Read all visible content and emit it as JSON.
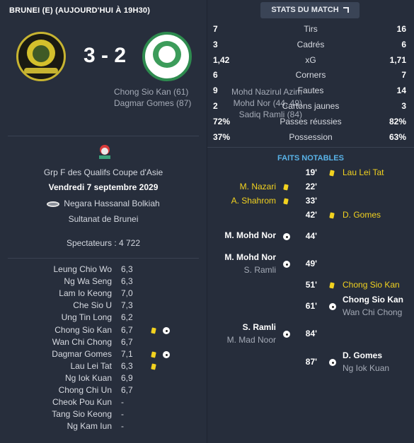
{
  "match": {
    "title": "BRUNEI (E) (AUJOURD'HUI À 19H30)",
    "score": "3 - 2",
    "home_crest": "brunei-crest",
    "away_crest": "macau-crest",
    "home_scorers": [
      "Mohd Nazirul Azim",
      "Mohd Nor (44, 49)",
      "Sadiq Ramli (84)"
    ],
    "away_scorers": [
      "Chong Sio Kan (61)",
      "Dagmar Gomes (87)"
    ],
    "competition": "Grp F des Qualifs Coupe d'Asie",
    "date": "Vendredi 7 septembre 2029",
    "stadium": "Negara Hassanal Bolkiah",
    "city": "Sultanat de Brunei",
    "attendance": "Spectateurs : 4 722"
  },
  "ratings": [
    {
      "name": "Leung Chio Wo",
      "rating": "6,3",
      "card": false,
      "goal": false
    },
    {
      "name": "Ng Wa Seng",
      "rating": "6,3",
      "card": false,
      "goal": false
    },
    {
      "name": "Lam Io Keong",
      "rating": "7,0",
      "card": false,
      "goal": false
    },
    {
      "name": "Che Sio U",
      "rating": "7,3",
      "card": false,
      "goal": false
    },
    {
      "name": "Ung Tin Long",
      "rating": "6,2",
      "card": false,
      "goal": false
    },
    {
      "name": "Chong Sio Kan",
      "rating": "6,7",
      "card": true,
      "goal": true
    },
    {
      "name": "Wan Chi Chong",
      "rating": "6,7",
      "card": false,
      "goal": false
    },
    {
      "name": "Dagmar Gomes",
      "rating": "7,1",
      "card": true,
      "goal": true
    },
    {
      "name": "Lau Lei Tat",
      "rating": "6,3",
      "card": true,
      "goal": false
    },
    {
      "name": "Ng Iok Kuan",
      "rating": "6,9",
      "card": false,
      "goal": false
    },
    {
      "name": "Chong Chi Un",
      "rating": "6,7",
      "card": false,
      "goal": false
    },
    {
      "name": "Cheok Pou Kun",
      "rating": "-",
      "card": false,
      "goal": false
    },
    {
      "name": "Tang Sio Keong",
      "rating": "-",
      "card": false,
      "goal": false
    },
    {
      "name": "Ng Kam Iun",
      "rating": "-",
      "card": false,
      "goal": false
    }
  ],
  "stats_button": "STATS DU MATCH",
  "stats": [
    {
      "home": "7",
      "label": "Tirs",
      "away": "16",
      "bold": false
    },
    {
      "home": "3",
      "label": "Cadrés",
      "away": "6",
      "bold": false
    },
    {
      "home": "1,42",
      "label": "xG",
      "away": "1,71",
      "bold": false
    },
    {
      "home": "6",
      "label": "Corners",
      "away": "7",
      "bold": false
    },
    {
      "home": "9",
      "label": "Fautes",
      "away": "14",
      "bold": false
    },
    {
      "home": "2",
      "label": "Cartons jaunes",
      "away": "3",
      "bold": false
    },
    {
      "home": "72%",
      "label": "Passes réussies",
      "away": "82%",
      "bold": true
    },
    {
      "home": "37%",
      "label": "Possession",
      "away": "63%",
      "bold": true
    }
  ],
  "facts_title": "FAITS NOTABLES",
  "events": [
    {
      "minute": "19'",
      "side": "away",
      "type": "card",
      "player": "Lau Lei Tat",
      "assist": ""
    },
    {
      "minute": "22'",
      "side": "home",
      "type": "card",
      "player": "M. Nazari",
      "assist": ""
    },
    {
      "minute": "33'",
      "side": "home",
      "type": "card",
      "player": "A. Shahrom",
      "assist": ""
    },
    {
      "minute": "42'",
      "side": "away",
      "type": "card",
      "player": "D. Gomes",
      "assist": ""
    },
    {
      "minute": "44'",
      "side": "home",
      "type": "goal",
      "player": "M. Mohd Nor",
      "assist": ""
    },
    {
      "minute": "49'",
      "side": "home",
      "type": "goal",
      "player": "M. Mohd Nor",
      "assist": "S. Ramli"
    },
    {
      "minute": "51'",
      "side": "away",
      "type": "card",
      "player": "Chong Sio Kan",
      "assist": ""
    },
    {
      "minute": "61'",
      "side": "away",
      "type": "goal",
      "player": "Chong Sio Kan",
      "assist": "Wan Chi Chong"
    },
    {
      "minute": "84'",
      "side": "home",
      "type": "goal",
      "player": "S. Ramli",
      "assist": "M. Mad Noor"
    },
    {
      "minute": "87'",
      "side": "away",
      "type": "goal",
      "player": "D. Gomes",
      "assist": "Ng Iok Kuan"
    }
  ]
}
